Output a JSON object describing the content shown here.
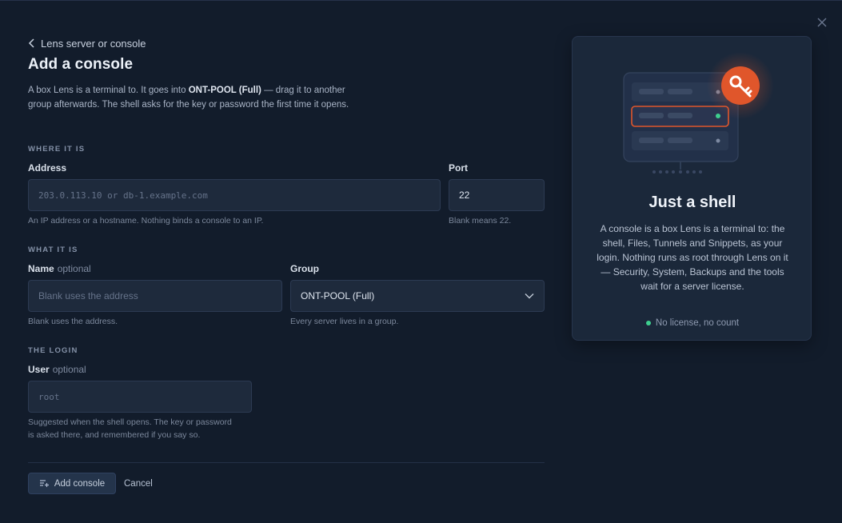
{
  "nav": {
    "back_label": "Lens server or console"
  },
  "page": {
    "title": "Add a console",
    "intro_before": "A box Lens is a terminal to. It goes into ",
    "intro_group": "ONT-POOL (Full)",
    "intro_after": " — drag it to another group afterwards. The shell asks for the key or password the first time it opens."
  },
  "where": {
    "section": "WHERE IT IS",
    "address": {
      "label": "Address",
      "placeholder": "203.0.113.10 or db-1.example.com",
      "help": "An IP address or a hostname. Nothing binds a console to an IP."
    },
    "port": {
      "label": "Port",
      "value": "22",
      "help": "Blank means 22."
    }
  },
  "what": {
    "section": "WHAT IT IS",
    "name": {
      "label": "Name",
      "optional": "optional",
      "placeholder": "Blank uses the address",
      "help": "Blank uses the address."
    },
    "group": {
      "label": "Group",
      "value": "ONT-POOL (Full)",
      "help": "Every server lives in a group."
    }
  },
  "login": {
    "section": "THE LOGIN",
    "user": {
      "label": "User",
      "optional": "optional",
      "placeholder": "root",
      "help_line1": "Suggested when the shell opens. The key or password",
      "help_line2": "is asked there, and remembered if you say so."
    }
  },
  "actions": {
    "add_label": "Add console",
    "cancel_label": "Cancel"
  },
  "card": {
    "title": "Just a shell",
    "body": "A console is a box Lens is a terminal to: the shell, Files, Tunnels and Snippets, as your login. Nothing runs as root through Lens on it — Security, System, Backups and the tools wait for a server license.",
    "footer": "No license, no count"
  },
  "colors": {
    "accent": "#e0562b",
    "success": "#3ecf8e",
    "background": "#121c2b",
    "card": "#1b283a"
  },
  "icons": {
    "close": "close-icon",
    "back": "chevron-left-icon",
    "add": "add-console-icon",
    "select": "chevron-down-icon",
    "key": "key-icon",
    "server": "server-rack-icon"
  }
}
